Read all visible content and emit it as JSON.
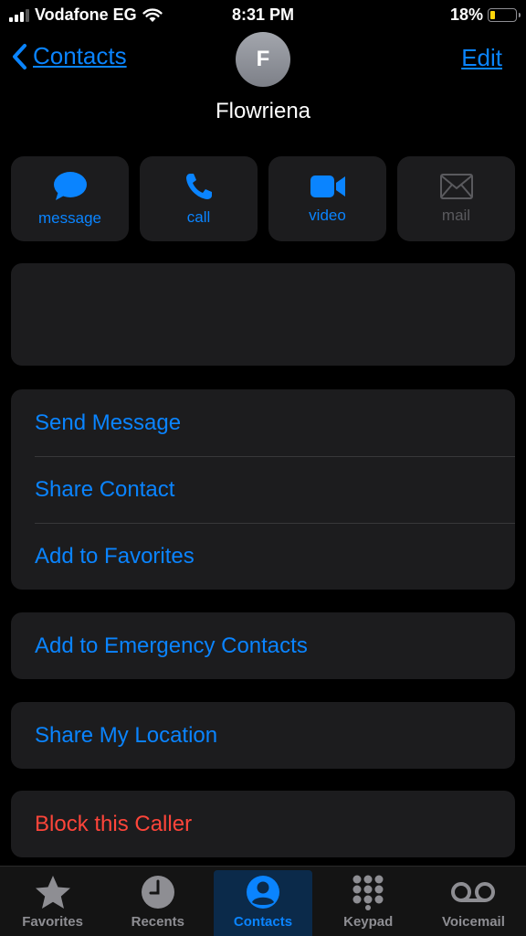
{
  "status_bar": {
    "carrier": "Vodafone EG",
    "time": "8:31 PM",
    "battery_percent": "18%",
    "battery_level": 0.18,
    "battery_color": "#ffd60a"
  },
  "nav": {
    "back_label": "Contacts",
    "edit_label": "Edit"
  },
  "contact": {
    "initial": "F",
    "name": "Flowriena"
  },
  "quick_actions": [
    {
      "label": "message",
      "icon": "message-bubble-icon",
      "enabled": true
    },
    {
      "label": "call",
      "icon": "phone-icon",
      "enabled": true
    },
    {
      "label": "video",
      "icon": "video-camera-icon",
      "enabled": true
    },
    {
      "label": "mail",
      "icon": "envelope-icon",
      "enabled": false
    }
  ],
  "group1": [
    "Send Message",
    "Share Contact",
    "Add to Favorites"
  ],
  "emergency": "Add to Emergency Contacts",
  "share_location": "Share My Location",
  "block": "Block this Caller",
  "tabs": [
    {
      "label": "Favorites",
      "icon": "star-icon",
      "active": false
    },
    {
      "label": "Recents",
      "icon": "clock-icon",
      "active": false
    },
    {
      "label": "Contacts",
      "icon": "person-circle-icon",
      "active": true
    },
    {
      "label": "Keypad",
      "icon": "keypad-icon",
      "active": false
    },
    {
      "label": "Voicemail",
      "icon": "voicemail-icon",
      "active": false
    }
  ],
  "colors": {
    "accent": "#0a84ff",
    "danger": "#ff453a",
    "card": "#1c1c1e",
    "background": "#000000"
  }
}
